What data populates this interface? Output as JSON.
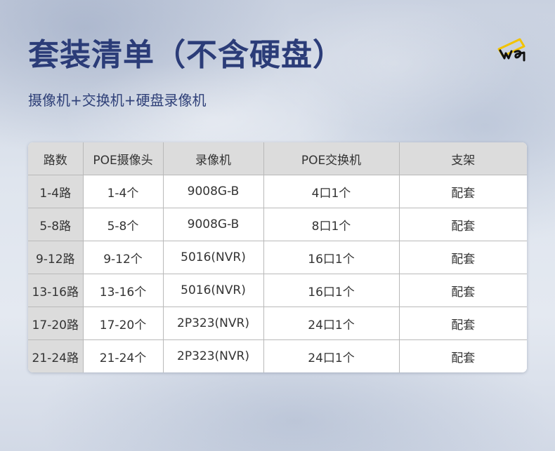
{
  "header": {
    "title": "套装清单（不含硬盘）",
    "subtitle": "摄像机+交换机+硬盘录像机",
    "logo_icon": "camera-logo-icon"
  },
  "table": {
    "columns": [
      "路数",
      "POE摄像头",
      "录像机",
      "POE交换机",
      "支架"
    ],
    "rows": [
      [
        "1-4路",
        "1-4个",
        "9008G-B",
        "4口1个",
        "配套"
      ],
      [
        "5-8路",
        "5-8个",
        "9008G-B",
        "8口1个",
        "配套"
      ],
      [
        "9-12路",
        "9-12个",
        "5016(NVR)",
        "16口1个",
        "配套"
      ],
      [
        "13-16路",
        "13-16个",
        "5016(NVR)",
        "16口1个",
        "配套"
      ],
      [
        "17-20路",
        "17-20个",
        "2P323(NVR)",
        "24口1个",
        "配套"
      ],
      [
        "21-24路",
        "21-24个",
        "2P323(NVR)",
        "24口1个",
        "配套"
      ]
    ]
  },
  "colors": {
    "title": "#2b3c78",
    "logo_accent": "#f2c300",
    "header_cell": "#dcdcdc"
  }
}
